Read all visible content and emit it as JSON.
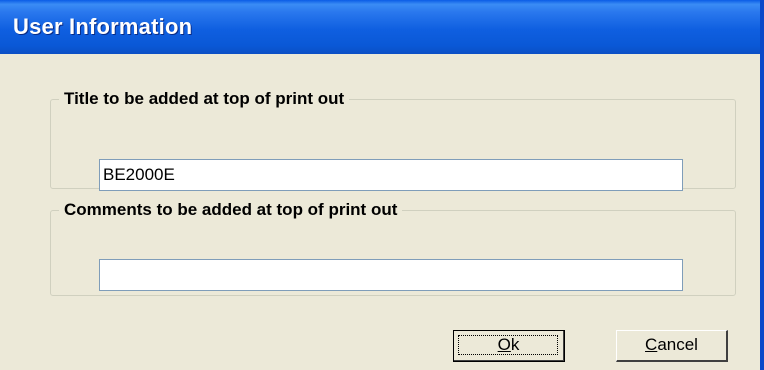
{
  "window": {
    "title": "User Information"
  },
  "title_group": {
    "label": "Title to be added at top of print out",
    "value": "BE2000E"
  },
  "comments_group": {
    "label": "Comments to be added at top of print out",
    "value": ""
  },
  "buttons": {
    "ok": {
      "mnemonic": "O",
      "rest": "k"
    },
    "cancel": {
      "mnemonic": "C",
      "rest": "ancel"
    }
  },
  "colors": {
    "titlebar": "#0a58d6",
    "dialog_bg": "#ece9d8",
    "group_border": "#d0d0bf",
    "textbox_border": "#7f9db9"
  }
}
